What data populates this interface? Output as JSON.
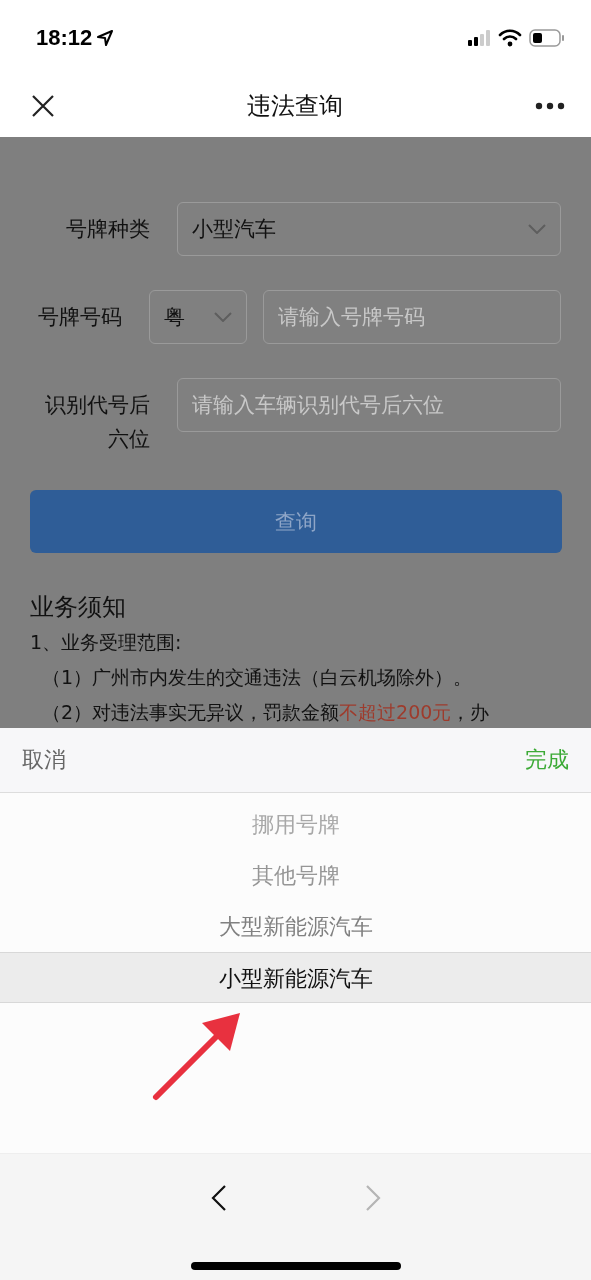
{
  "status_bar": {
    "time": "18:12"
  },
  "nav_bar": {
    "title": "违法查询"
  },
  "form": {
    "rows": [
      {
        "label": "号牌种类",
        "kind": "select",
        "value": "小型汽车"
      },
      {
        "label": "号牌号码",
        "kind": "plate",
        "prefix": "粤",
        "placeholder": "请输入号牌号码"
      },
      {
        "label": "识别代号后六位",
        "kind": "input",
        "placeholder": "请输入车辆识别代号后六位"
      }
    ],
    "submit": "查询"
  },
  "notice": {
    "title": "业务须知",
    "lines": [
      {
        "indent": false,
        "segments": [
          {
            "text": "1、业务受理范围:",
            "highlight": false
          }
        ]
      },
      {
        "indent": true,
        "segments": [
          {
            "text": "（1）广州市内发生的交通违法（白云机场除外）。",
            "highlight": false
          }
        ]
      },
      {
        "indent": true,
        "segments": [
          {
            "text": "（2）对违法事实无异议，罚款金额",
            "highlight": false
          },
          {
            "text": "不超过200元",
            "highlight": true
          },
          {
            "text": "，办",
            "highlight": false
          }
        ]
      }
    ]
  },
  "picker": {
    "cancel": "取消",
    "done": "完成",
    "options": [
      {
        "label": "挪用号牌",
        "selected": false
      },
      {
        "label": "其他号牌",
        "selected": false
      },
      {
        "label": "大型新能源汽车",
        "selected": false
      },
      {
        "label": "小型新能源汽车",
        "selected": true
      }
    ]
  },
  "toolbar": {
    "back_enabled": true,
    "forward_enabled": false
  }
}
